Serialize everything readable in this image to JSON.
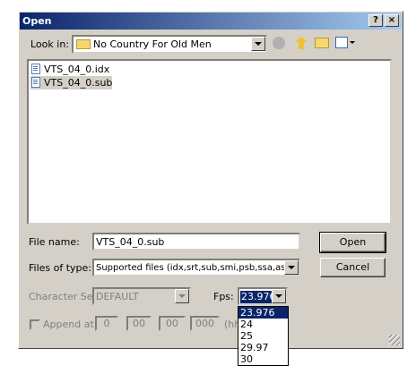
{
  "dialog": {
    "title": "Open",
    "help_btn": "?",
    "close_btn": "×"
  },
  "look_in": {
    "label": "Look in:",
    "value": "No Country For Old Men"
  },
  "files": [
    {
      "name": "VTS_04_0.idx"
    },
    {
      "name": "VTS_04_0.sub"
    }
  ],
  "file_name": {
    "label": "File name:",
    "value": "VTS_04_0.sub"
  },
  "file_type": {
    "label": "Files of type:",
    "value": "Supported files (idx,srt,sub,smi,psb,ssa,ass,v:"
  },
  "buttons": {
    "open": "Open",
    "cancel": "Cancel"
  },
  "charset": {
    "label": "Character Set:",
    "value": "DEFAULT"
  },
  "fps": {
    "label": "Fps:",
    "value": "23.976",
    "options": [
      "23.976",
      "24",
      "25",
      "29.97",
      "30"
    ]
  },
  "append": {
    "label": "Append at:",
    "fields": [
      "0",
      "00",
      "00",
      "000"
    ],
    "hint": "(hh"
  },
  "colors": {
    "title_start": "#0a246a",
    "title_end": "#a6caf0",
    "dialog_bg": "#d4d0c8",
    "selection": "#0a246a"
  }
}
